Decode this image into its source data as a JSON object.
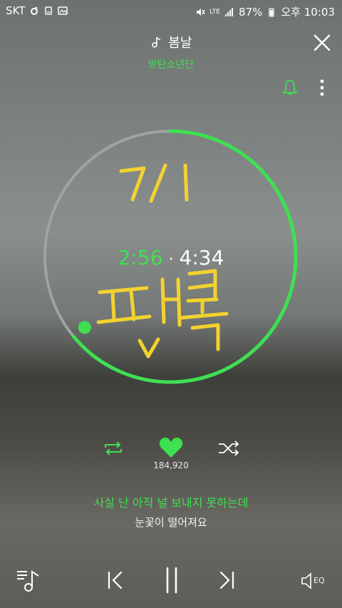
{
  "status_bar": {
    "carrier": "SKT",
    "network": "LTE",
    "battery": "87%",
    "clock": "오후 10:03"
  },
  "header": {
    "song_title": "봄날",
    "artist": "방탄소년단"
  },
  "player": {
    "time_current": "2:56",
    "time_separator": "·",
    "time_total": "4:34",
    "progress_fraction": 0.64,
    "handwriting_line1": "7/1",
    "handwriting_line2": "팬독"
  },
  "actions": {
    "like_count": "184,920"
  },
  "lyrics": {
    "current": "사실 난 아직 널 보내지 못하는데",
    "next": "눈꽃이 떨어져요"
  },
  "bottom_bar": {
    "eq_label": "EQ"
  },
  "colors": {
    "accent": "#3ee052",
    "handwriting": "#f3d230"
  }
}
